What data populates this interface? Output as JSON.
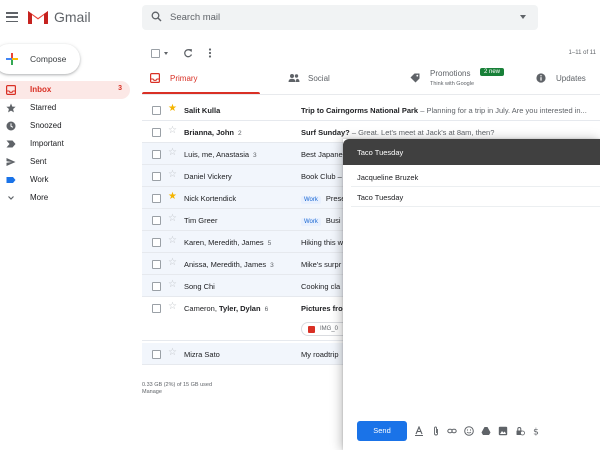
{
  "app": {
    "name": "Gmail",
    "brand_red": "#d93025",
    "accent_blue": "#1a73e8"
  },
  "search": {
    "placeholder": "Search mail"
  },
  "compose_button": {
    "label": "Compose"
  },
  "sidebar": {
    "items": [
      {
        "label": "Inbox",
        "count": "3",
        "icon": "inbox-icon",
        "active": true
      },
      {
        "label": "Starred",
        "icon": "star-icon"
      },
      {
        "label": "Snoozed",
        "icon": "clock-icon"
      },
      {
        "label": "Important",
        "icon": "important-icon"
      },
      {
        "label": "Sent",
        "icon": "send-icon"
      },
      {
        "label": "Work",
        "icon": "label-icon"
      },
      {
        "label": "More",
        "icon": "chevron-down-icon"
      }
    ]
  },
  "toolbar": {
    "pager": "1–11 of 11"
  },
  "tabs": [
    {
      "label": "Primary",
      "icon": "inbox-icon",
      "active": true
    },
    {
      "label": "Social",
      "icon": "people-icon"
    },
    {
      "label": "Promotions",
      "icon": "tag-icon",
      "badge": "2 new",
      "sub": "Think with Google"
    },
    {
      "label": "Updates",
      "icon": "info-icon"
    }
  ],
  "emails": [
    {
      "sender": "Salit Kulla",
      "count": "",
      "subject": "Trip to Cairngorms National Park",
      "snippet": " – Planning for a trip in July. Are you interested in...",
      "starred": true,
      "unread": true,
      "label": ""
    },
    {
      "sender": "Brianna, John",
      "count": "2",
      "subject": "Surf Sunday?",
      "snippet": " – Great. Let's meet at Jack's at 8am, then?",
      "starred": false,
      "unread": true,
      "label": ""
    },
    {
      "sender": "Luis, me, Anastasia",
      "count": "3",
      "subject": "Best Japanese",
      "snippet": "",
      "starred": false,
      "unread": false,
      "label": ""
    },
    {
      "sender": "Daniel Vickery",
      "count": "",
      "subject": "Book Club – ",
      "snippet": "",
      "starred": false,
      "unread": false,
      "label": ""
    },
    {
      "sender": "Nick Kortendick",
      "count": "",
      "subject": "Presen",
      "snippet": "",
      "starred": true,
      "unread": false,
      "label": "Work"
    },
    {
      "sender": "Tim Greer",
      "count": "",
      "subject": "Busi",
      "snippet": "",
      "starred": false,
      "unread": false,
      "label": "Work"
    },
    {
      "sender": "Karen, Meredith, James",
      "count": "5",
      "subject": "Hiking this w",
      "snippet": "",
      "starred": false,
      "unread": false,
      "label": ""
    },
    {
      "sender": "Anissa, Meredith, James",
      "count": "3",
      "subject": "Mike's surpr",
      "snippet": "",
      "starred": false,
      "unread": false,
      "label": ""
    },
    {
      "sender": "Song Chi",
      "count": "",
      "subject": "Cooking cla",
      "snippet": "",
      "starred": false,
      "unread": false,
      "label": ""
    },
    {
      "sender_plain": "Cameron, ",
      "sender_bold": "Tyler, Dylan",
      "count": "6",
      "subject": "Pictures fro",
      "snippet": "",
      "starred": false,
      "unread": true,
      "label": "",
      "attachment": "IMG_0"
    },
    {
      "sender": "Mizra Sato",
      "count": "",
      "subject": "My roadtrip",
      "snippet": "",
      "starred": false,
      "unread": false,
      "label": ""
    }
  ],
  "storage": {
    "line1": "0.33 GB (2%) of 15 GB used",
    "line2": "Manage"
  },
  "compose_window": {
    "title": "Taco Tuesday",
    "to": "Jacqueline Bruzek",
    "subject": "Taco Tuesday",
    "send_label": "Send"
  }
}
